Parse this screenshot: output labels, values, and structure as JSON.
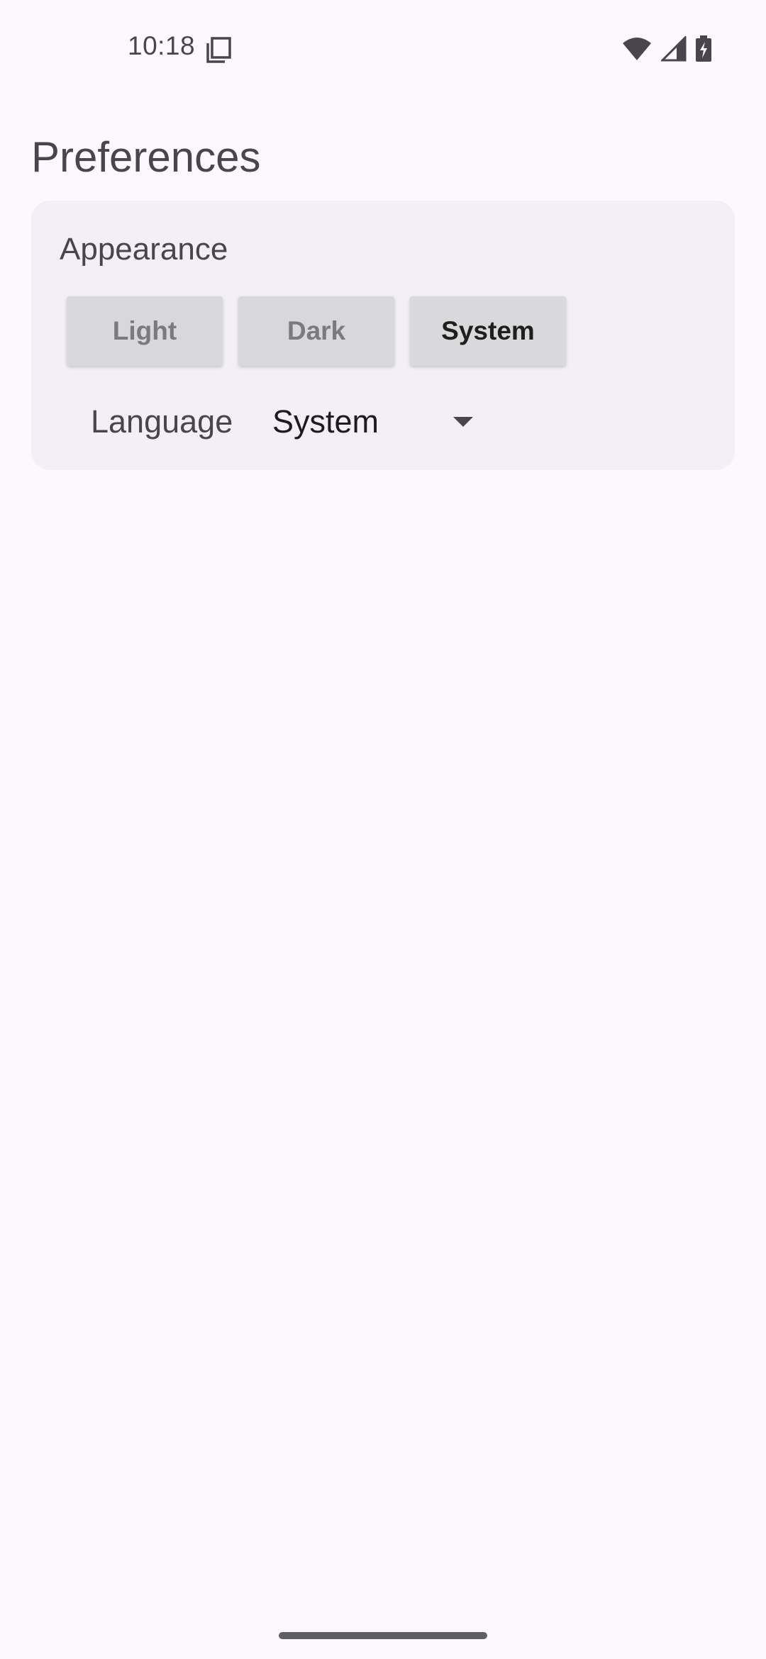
{
  "status_bar": {
    "time": "10:18",
    "icons": [
      "notification-copy-icon",
      "wifi-icon",
      "cellular-signal-icon",
      "battery-charging-icon"
    ]
  },
  "page": {
    "title": "Preferences"
  },
  "appearance": {
    "heading": "Appearance",
    "options": [
      "Light",
      "Dark",
      "System"
    ],
    "selected": "System"
  },
  "language": {
    "label": "Language",
    "value": "System"
  },
  "colors": {
    "background": "#fdf8fd",
    "card": "#f2eff6",
    "text_secondary": "#49454f",
    "button_bg": "#d8d8da"
  }
}
